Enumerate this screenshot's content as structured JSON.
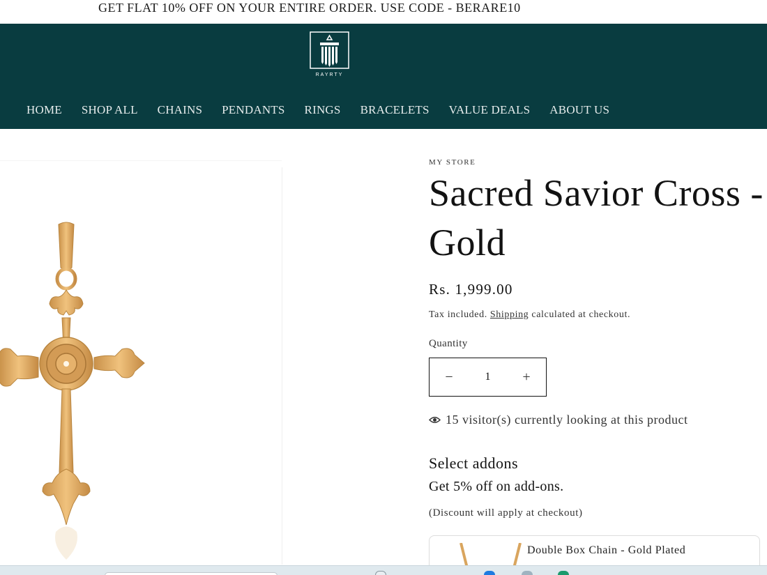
{
  "announcement": "GET FLAT 10% OFF ON YOUR ENTIRE ORDER. USE CODE - BERARE10",
  "brand": {
    "name": "RAYRTY",
    "header_color": "#093c40"
  },
  "nav": [
    "HOME",
    "SHOP ALL",
    "CHAINS",
    "PENDANTS",
    "RINGS",
    "BRACELETS",
    "VALUE DEALS",
    "ABOUT US"
  ],
  "product": {
    "vendor": "MY STORE",
    "title": "Sacred Savior Cross - Gold",
    "price": "Rs. 1,999.00",
    "tax_prefix": "Tax included.",
    "shipping_link": "Shipping",
    "tax_suffix": "calculated at checkout.",
    "quantity_label": "Quantity",
    "quantity": "1",
    "minus": "−",
    "plus": "+",
    "visitors": "15 visitor(s) currently looking at this product"
  },
  "addons": {
    "heading": "Select addons",
    "offer": "Get 5% off on add-ons.",
    "note": "(Discount will apply at checkout)",
    "items": [
      {
        "name": "Double Box Chain - Gold Plated"
      }
    ]
  },
  "colors": {
    "gold": "#d9a55e",
    "gold_dark": "#b8853f"
  }
}
